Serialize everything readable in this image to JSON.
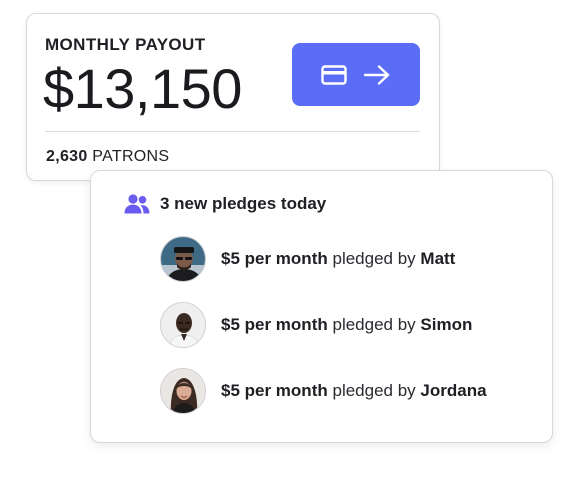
{
  "payout": {
    "heading": "MONTHLY PAYOUT",
    "amount": "$13,150",
    "patrons_count": "2,630",
    "patrons_label": "PATRONS",
    "button_icons": [
      "credit-card-icon",
      "arrow-right-icon"
    ],
    "accent_color": "#5b6cf6"
  },
  "pledges": {
    "header_icon": "users-icon",
    "header_icon_color": "#6b5cf0",
    "title": "3 new pledges today",
    "items": [
      {
        "amount": "$5 per month",
        "connector": "pledged by",
        "name": "Matt"
      },
      {
        "amount": "$5 per month",
        "connector": "pledged by",
        "name": "Simon"
      },
      {
        "amount": "$5 per month",
        "connector": "pledged by",
        "name": "Jordana"
      }
    ]
  }
}
